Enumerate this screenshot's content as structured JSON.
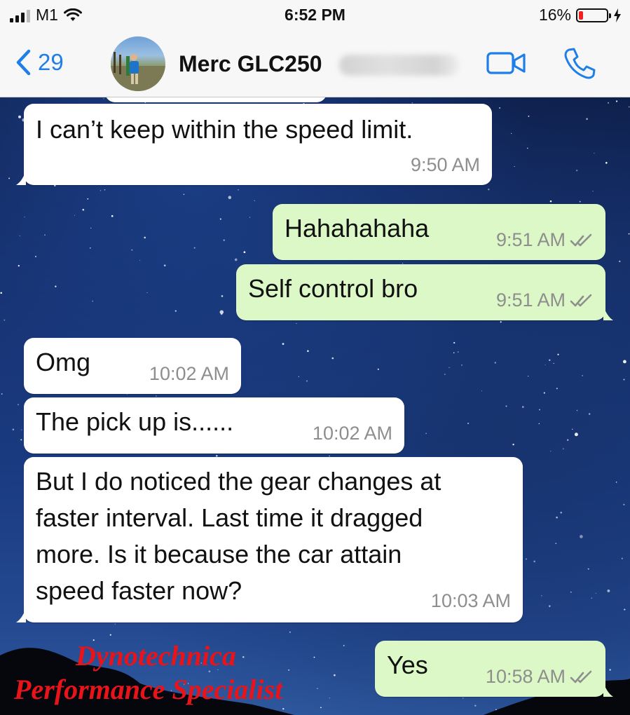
{
  "status_bar": {
    "carrier": "M1",
    "time": "6:52 PM",
    "battery_percent_label": "16%",
    "battery_level": 0.16,
    "signal_bars": 3
  },
  "header": {
    "back_count": "29",
    "contact_name": "Merc GLC250",
    "accent_color": "#1f7ee8"
  },
  "messages": [
    {
      "direction": "incoming",
      "text": "I can’t keep within the speed limit.",
      "time": "9:50 AM"
    },
    {
      "direction": "outgoing",
      "text": "Hahahahaha",
      "time": "9:51 AM",
      "status": "read"
    },
    {
      "direction": "outgoing",
      "text": "Self control bro",
      "time": "9:51 AM",
      "status": "read"
    },
    {
      "direction": "incoming",
      "text": "Omg",
      "time": "10:02 AM"
    },
    {
      "direction": "incoming",
      "text": "The pick up is......",
      "time": "10:02 AM"
    },
    {
      "direction": "incoming",
      "lines": [
        "But I do noticed the gear changes at",
        "faster interval. Last time it dragged",
        "more. Is it because the car attain",
        "speed faster now?"
      ],
      "time": "10:03 AM"
    },
    {
      "direction": "outgoing",
      "text": "Yes",
      "time": "10:58 AM",
      "status": "read"
    }
  ],
  "watermark": {
    "line1": "Dynotechnica",
    "line2": "Performance Specialist",
    "color": "#e8141a"
  },
  "colors": {
    "incoming_bubble": "#ffffff",
    "outgoing_bubble": "#dcf8c6",
    "read_ticks": "#8e8e8e"
  }
}
